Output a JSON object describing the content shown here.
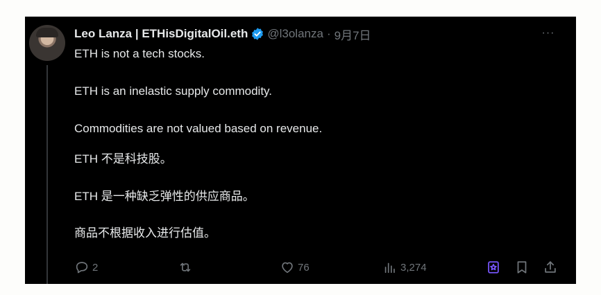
{
  "author": {
    "display_name": "Leo Lanza | ETHisDigitalOil.eth",
    "handle": "@l3olanza",
    "separator": "·",
    "date": "9月7日",
    "verified_color": "#1d9bf0"
  },
  "more_label": "···",
  "tweet_lines": [
    "ETH is not a tech stocks.",
    "ETH is an inelastic supply commodity.",
    "Commodities are not valued based on revenue.",
    "ETH 不是科技股。",
    "ETH 是一种缺乏弹性的供应商品。",
    "商品不根据收入进行估值。"
  ],
  "actions": {
    "reply": {
      "icon": "reply-icon",
      "count": "2"
    },
    "retweet": {
      "icon": "retweet-icon",
      "count": ""
    },
    "like": {
      "icon": "heart-icon",
      "count": "76"
    },
    "views": {
      "icon": "views-icon",
      "count": "3,274"
    },
    "grok": {
      "icon": "grok-icon",
      "color": "#7856ff"
    },
    "bookmark": {
      "icon": "bookmark-icon"
    },
    "share": {
      "icon": "share-icon"
    }
  },
  "colors": {
    "background": "#000000",
    "text": "#e7e9ea",
    "muted": "#71767b",
    "page": "#fdfdfb"
  }
}
